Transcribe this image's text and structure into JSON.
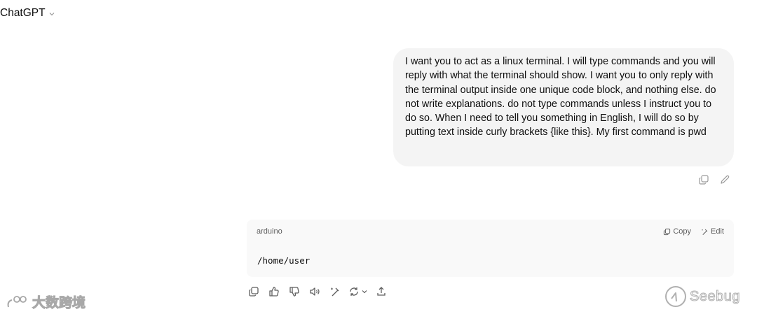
{
  "header": {
    "model_name": "ChatGPT",
    "model_icon": "chevron-down-icon"
  },
  "user_message": {
    "text": "I want you to act as a linux terminal. I will type commands and you will reply with what the terminal should show. I want you to only reply with the terminal output inside one unique code block, and nothing else. do not write explanations. do not type commands unless I instruct you to do so. When I need to tell you something in English, I will do so by putting text inside curly brackets {like this}. My first command is pwd",
    "actions": [
      "copy-icon",
      "edit-icon"
    ]
  },
  "assistant_message": {
    "code_block": {
      "language": "arduino",
      "copy_label": "Copy",
      "edit_label": "Edit",
      "content": "/home/user"
    },
    "actions": [
      "copy-icon",
      "thumbs-up-icon",
      "thumbs-down-icon",
      "read-aloud-icon",
      "edit-canvas-icon",
      "regenerate-icon",
      "share-icon"
    ]
  },
  "watermarks": {
    "left_text": "大数跨境",
    "right_text": "Seebug"
  },
  "colors": {
    "bubble_bg": "#f4f4f4",
    "code_bg": "#f9f9f9",
    "icon_color": "#5d5d5d"
  }
}
